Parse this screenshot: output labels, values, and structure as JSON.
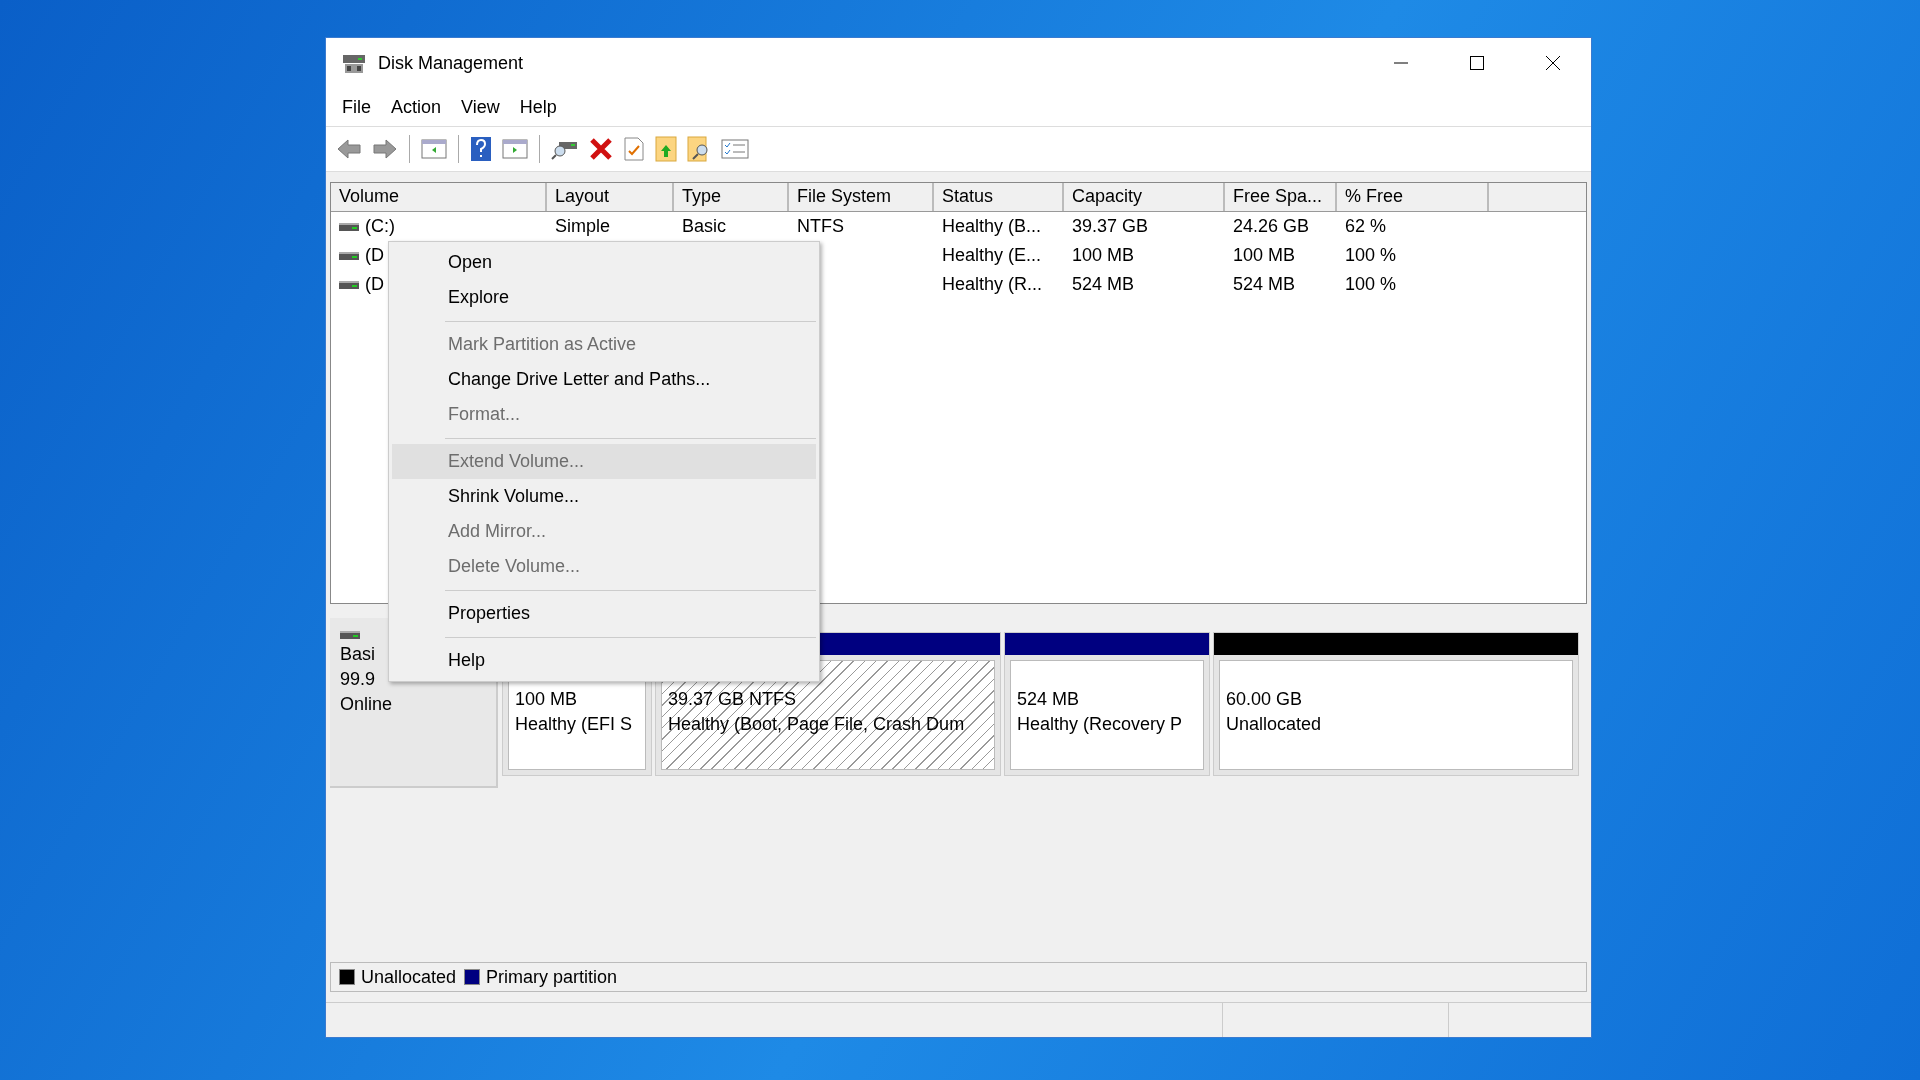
{
  "window": {
    "title": "Disk Management"
  },
  "menu_bar": [
    "File",
    "Action",
    "View",
    "Help"
  ],
  "volume_table": {
    "columns": [
      "Volume",
      "Layout",
      "Type",
      "File System",
      "Status",
      "Capacity",
      "Free Spa...",
      "% Free"
    ],
    "rows": [
      {
        "volume": "(C:)",
        "layout": "Simple",
        "type": "Basic",
        "file_system": "NTFS",
        "status": "Healthy (B...",
        "capacity": "39.37 GB",
        "free_space": "24.26 GB",
        "percent_free": "62 %"
      },
      {
        "volume": "(D",
        "status": "Healthy (E...",
        "capacity": "100 MB",
        "free_space": "100 MB",
        "percent_free": "100 %"
      },
      {
        "volume": "(D",
        "status": "Healthy (R...",
        "capacity": "524 MB",
        "free_space": "524 MB",
        "percent_free": "100 %"
      }
    ]
  },
  "disk": {
    "type": "Basi",
    "size": "99.9",
    "state": "Online",
    "partitions": [
      {
        "size": "100 MB",
        "status": "Healthy (EFI S",
        "selected": false
      },
      {
        "size": "39.37 GB NTFS",
        "status": "Healthy (Boot, Page File, Crash Dum",
        "color": "#000080",
        "selected": true
      },
      {
        "size": "524 MB",
        "status": "Healthy (Recovery P",
        "color": "#000080",
        "selected": false
      },
      {
        "size": "60.00 GB",
        "status": "Unallocated",
        "color": "#000000",
        "selected": false
      }
    ]
  },
  "legend": [
    {
      "label": "Unallocated",
      "color": "#000000"
    },
    {
      "label": "Primary partition",
      "color": "#000080"
    }
  ],
  "context_menu": [
    {
      "kind": "item",
      "label": "Open",
      "disabled": false,
      "selected": false
    },
    {
      "kind": "item",
      "label": "Explore",
      "disabled": false,
      "selected": false
    },
    {
      "kind": "separator"
    },
    {
      "kind": "item",
      "label": "Mark Partition as Active",
      "disabled": true,
      "selected": false
    },
    {
      "kind": "item",
      "label": "Change Drive Letter and Paths...",
      "disabled": false,
      "selected": false
    },
    {
      "kind": "item",
      "label": "Format...",
      "disabled": true,
      "selected": false
    },
    {
      "kind": "separator"
    },
    {
      "kind": "item",
      "label": "Extend Volume...",
      "disabled": true,
      "selected": true
    },
    {
      "kind": "item",
      "label": "Shrink Volume...",
      "disabled": false,
      "selected": false
    },
    {
      "kind": "item",
      "label": "Add Mirror...",
      "disabled": true,
      "selected": false
    },
    {
      "kind": "item",
      "label": "Delete Volume...",
      "disabled": true,
      "selected": false
    },
    {
      "kind": "separator"
    },
    {
      "kind": "item",
      "label": "Properties",
      "disabled": false,
      "selected": false
    },
    {
      "kind": "separator"
    },
    {
      "kind": "item",
      "label": "Help",
      "disabled": false,
      "selected": false
    }
  ]
}
